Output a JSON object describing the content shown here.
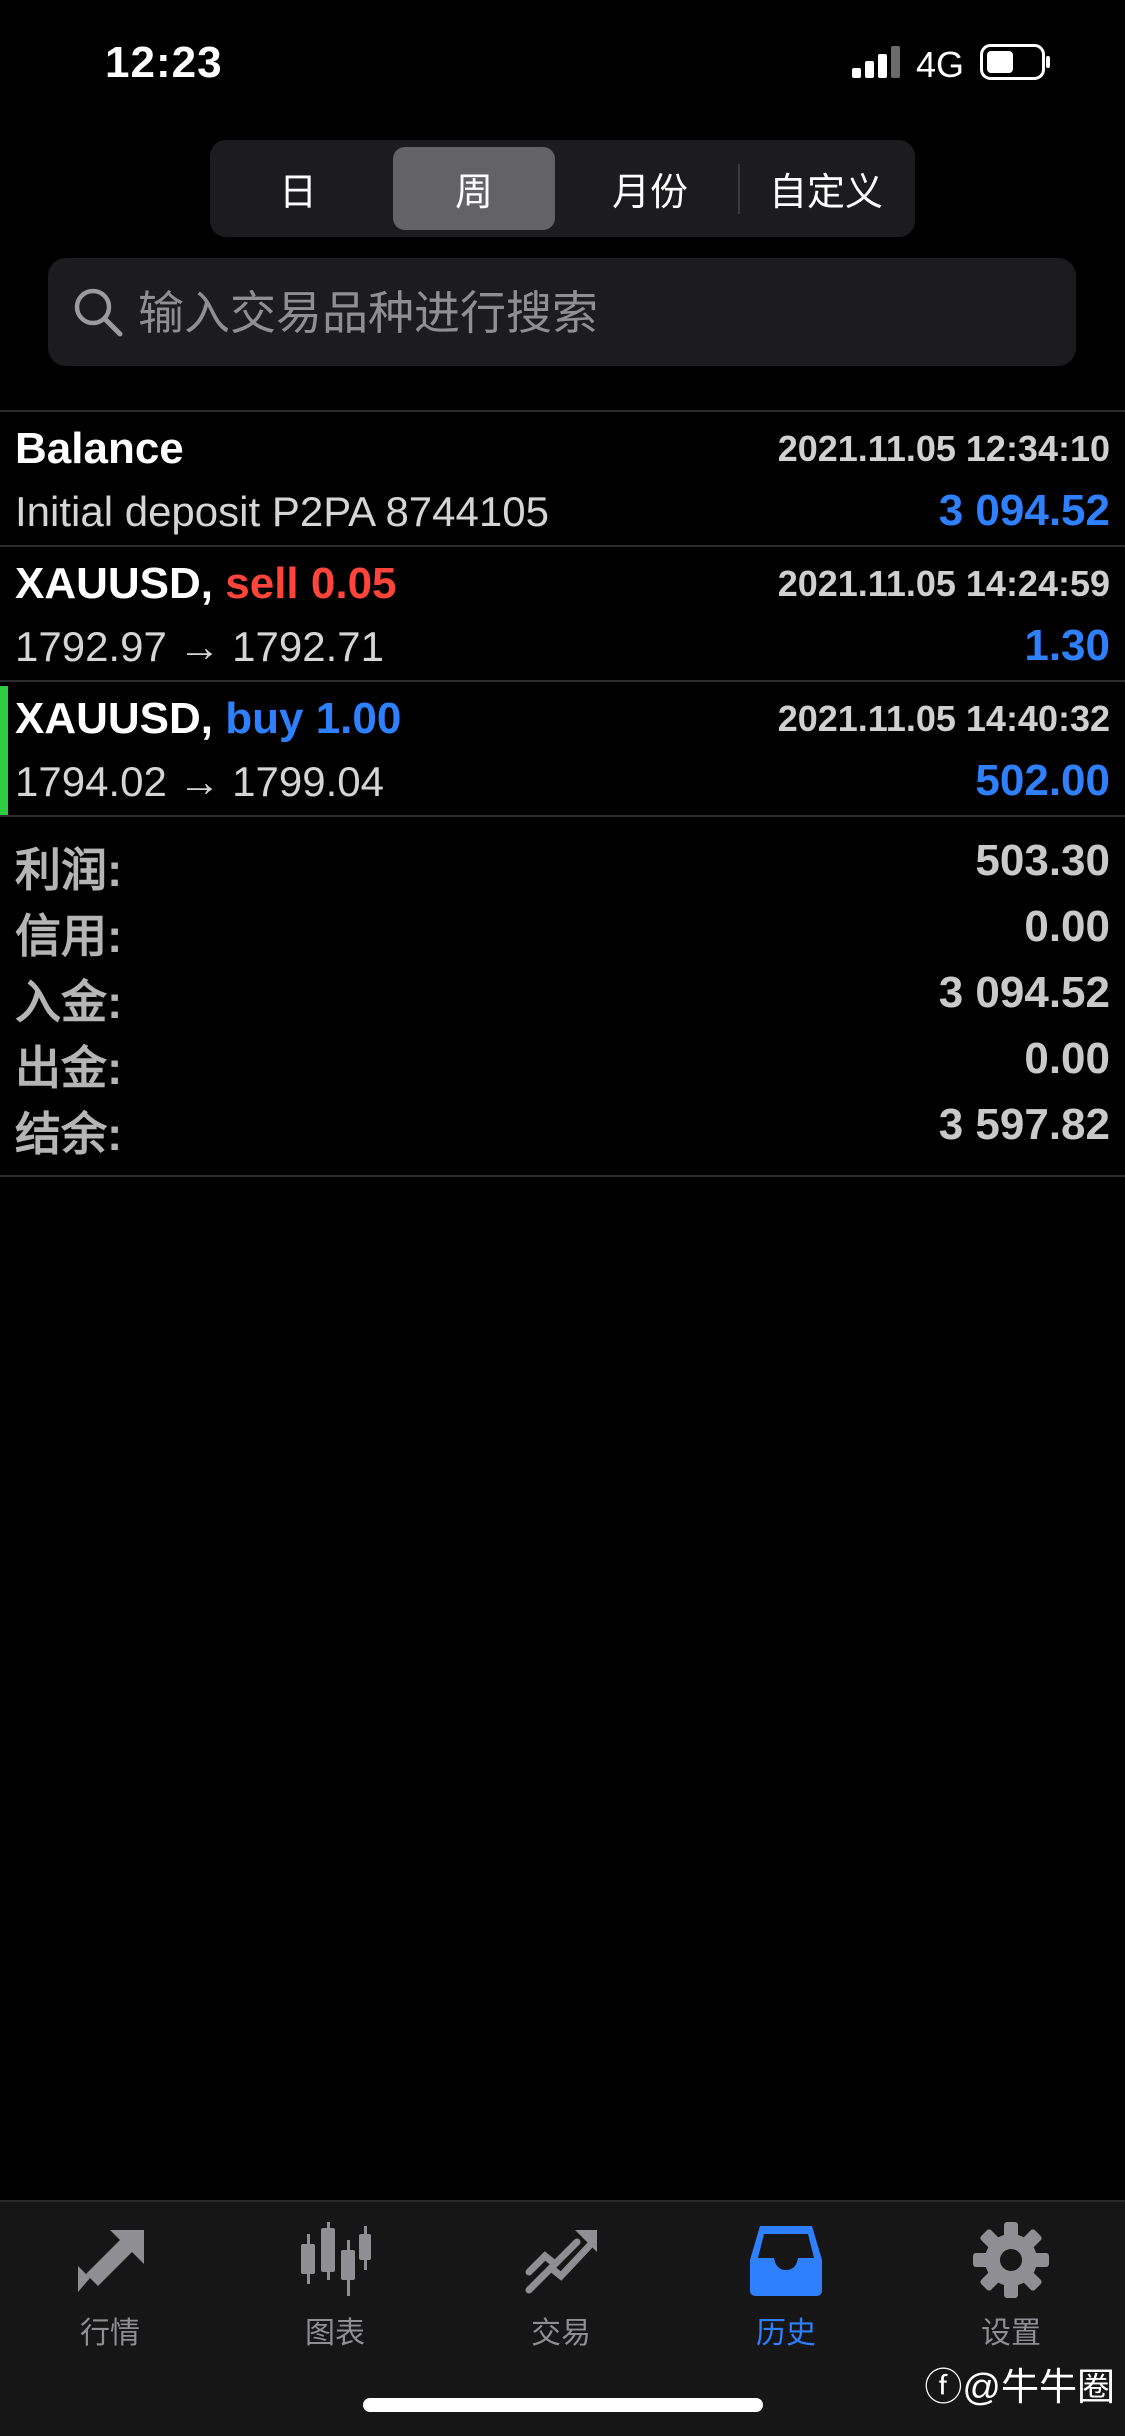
{
  "status_bar": {
    "time": "12:23",
    "network": "4G"
  },
  "period_tabs": [
    {
      "label": "日",
      "active": false
    },
    {
      "label": "周",
      "active": true
    },
    {
      "label": "月份",
      "active": false
    },
    {
      "label": "自定义",
      "active": false
    }
  ],
  "search": {
    "placeholder": "输入交易品种进行搜索"
  },
  "history": [
    {
      "title": "Balance",
      "side": "",
      "subtitle": "Initial deposit P2PA 8744105",
      "time": "2021.11.05 12:34:10",
      "amount": "3 094.52"
    },
    {
      "symbol": "XAUUSD,",
      "side": "sell 0.05",
      "subtitle": "1792.97 → 1792.71",
      "time": "2021.11.05 14:24:59",
      "amount": "1.30"
    },
    {
      "symbol": "XAUUSD,",
      "side": "buy 1.00",
      "subtitle": "1794.02 → 1799.04",
      "time": "2021.11.05 14:40:32",
      "amount": "502.00"
    }
  ],
  "summary": [
    {
      "label": "利润:",
      "value": "503.30"
    },
    {
      "label": "信用:",
      "value": "0.00"
    },
    {
      "label": "入金:",
      "value": "3 094.52"
    },
    {
      "label": "出金:",
      "value": "0.00"
    },
    {
      "label": "结余:",
      "value": "3 597.82"
    }
  ],
  "tabbar": [
    {
      "label": "行情",
      "icon": "quotes-arrows-icon",
      "active": false
    },
    {
      "label": "图表",
      "icon": "candlestick-chart-icon",
      "active": false
    },
    {
      "label": "交易",
      "icon": "trade-trend-icon",
      "active": false
    },
    {
      "label": "历史",
      "icon": "inbox-tray-icon",
      "active": true
    },
    {
      "label": "设置",
      "icon": "gear-icon",
      "active": false
    }
  ],
  "watermark": "@牛牛圈",
  "colors": {
    "accent": "#2f80ff",
    "sell": "#ff453a",
    "buy": "#2f80ff",
    "position_marker": "#2ecc40"
  }
}
